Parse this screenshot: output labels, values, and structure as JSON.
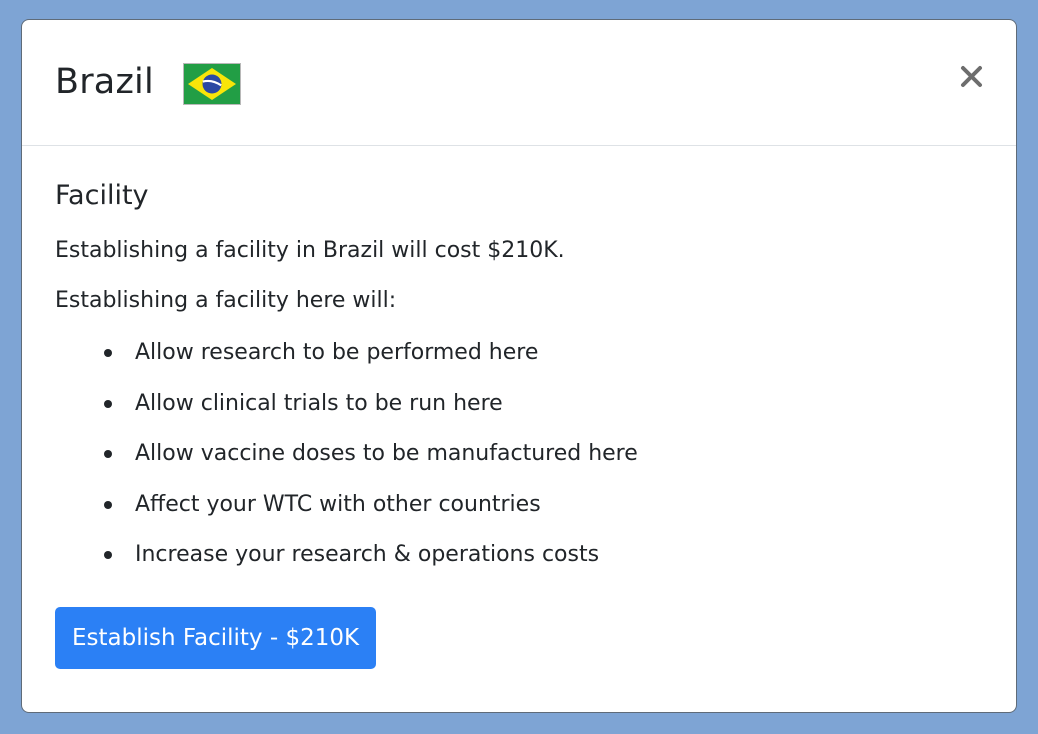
{
  "modal": {
    "title": "Brazil",
    "flag_icon": "brazil-flag-icon",
    "close_icon": "close-icon",
    "colors": {
      "backdrop": "#7ea4d4",
      "primary": "#2b80f5",
      "flag_green": "#229e45",
      "flag_yellow": "#f8e509",
      "flag_blue": "#2b49a3"
    }
  },
  "facility": {
    "heading": "Facility",
    "cost_text": "Establishing a facility in Brazil will cost $210K.",
    "intro_text": "Establishing a facility here will:",
    "effects": [
      "Allow research to be performed here",
      "Allow clinical trials to be run here",
      "Allow vaccine doses to be manufactured here",
      "Affect your WTC with other countries",
      "Increase your research & operations costs"
    ],
    "button_label": "Establish Facility - $210K"
  }
}
